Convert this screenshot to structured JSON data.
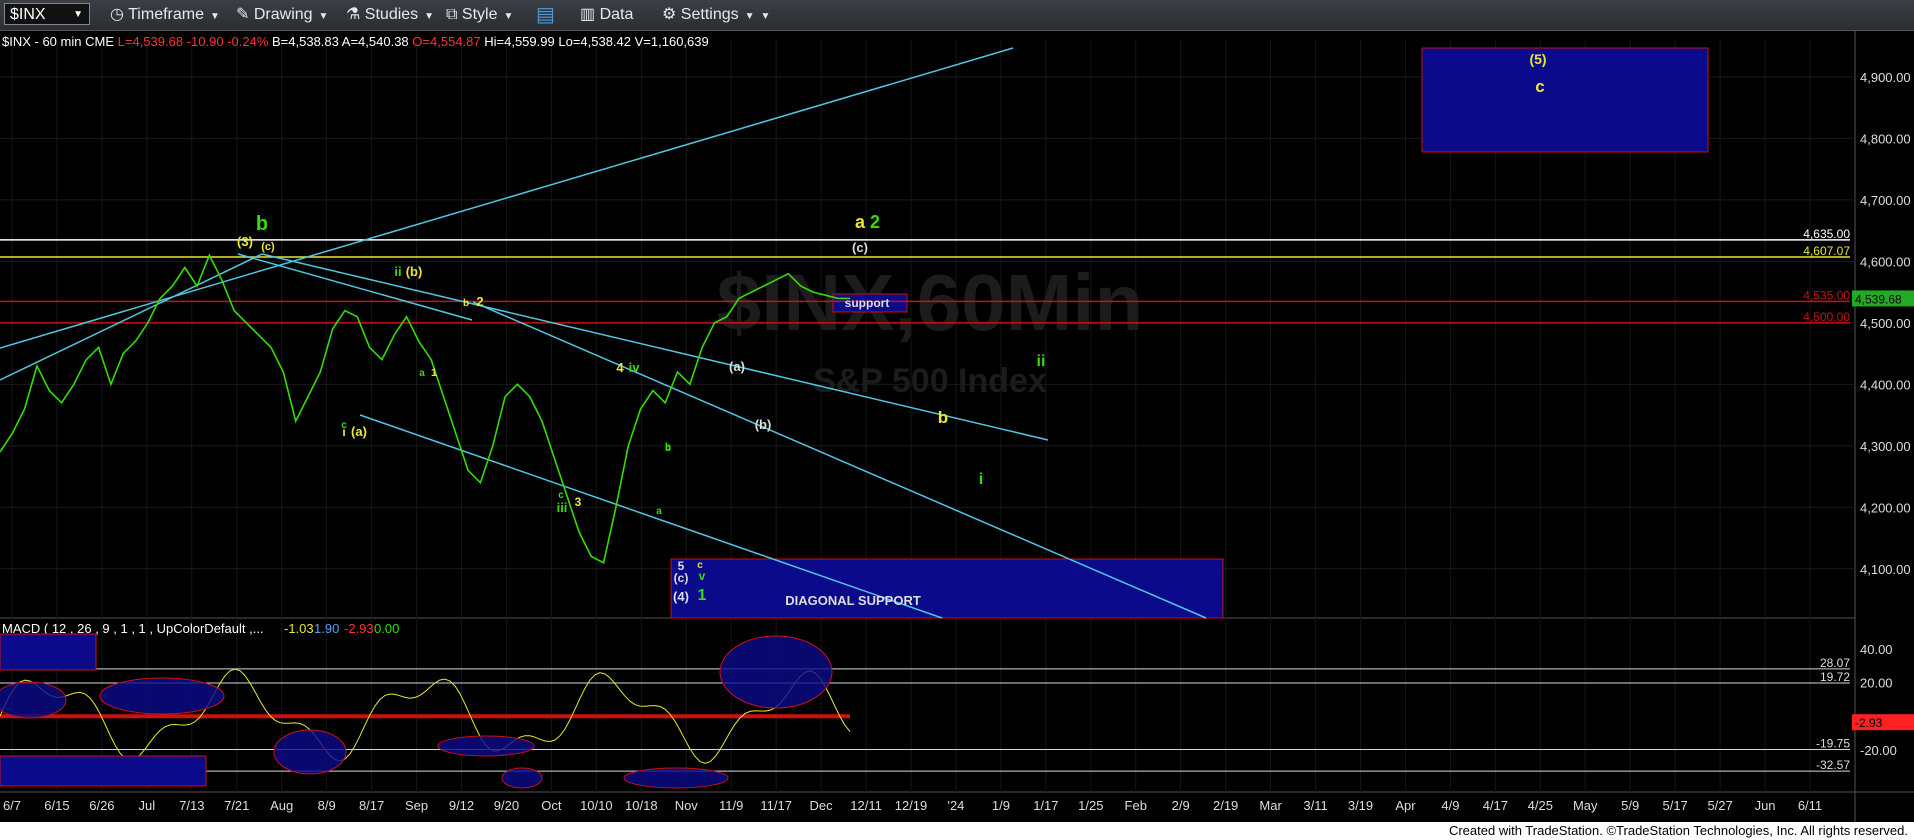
{
  "toolbar": {
    "symbol": "$INX",
    "items": [
      {
        "label": "Timeframe",
        "icon": "clock-icon"
      },
      {
        "label": "Drawing",
        "icon": "pencil-icon"
      },
      {
        "label": "Studies",
        "icon": "flask-icon"
      },
      {
        "label": "Style",
        "icon": "style-icon"
      },
      {
        "label": "",
        "icon": "layout-icon"
      },
      {
        "label": "Data",
        "icon": "bar-chart-icon"
      },
      {
        "label": "Settings",
        "icon": "gear-icon"
      }
    ]
  },
  "symbol_line": {
    "name": "$INX - 60 min",
    "exchange": "CME",
    "last": "L=4,539.68",
    "change": "-10.90",
    "pct": "-0.24%",
    "bid": "B=4,538.83",
    "ask": "A=4,540.38",
    "open": "O=4,554.87",
    "high": "Hi=4,559.99",
    "low": "Lo=4,538.42",
    "volume": "V=1,160,639"
  },
  "watermark": {
    "title": "$INX,60Min",
    "subtitle": "S&P 500 Index"
  },
  "colors": {
    "wave_green": "#33dd00",
    "label_yellow": "#e8e830",
    "trendline": "#4fc8e0",
    "target_box": "#0a0a8a",
    "red_line": "#cc1111",
    "white_line": "#ffffff"
  },
  "footer": "Created with TradeStation. ©TradeStation Technologies, Inc. All rights reserved.",
  "chart_data": [
    {
      "type": "line",
      "title": "$INX - 60 min",
      "x_ticks": [
        "6/7",
        "6/15",
        "6/26",
        "Jul",
        "7/13",
        "7/21",
        "Aug",
        "8/9",
        "8/17",
        "Sep",
        "9/12",
        "9/20",
        "Oct",
        "10/10",
        "10/18",
        "Nov",
        "11/9",
        "11/17",
        "Dec",
        "12/11",
        "12/19",
        "'24",
        "1/9",
        "1/17",
        "1/25",
        "Feb",
        "2/9",
        "2/19",
        "Mar",
        "3/11",
        "3/19",
        "Apr",
        "4/9",
        "4/17",
        "4/25",
        "May",
        "5/9",
        "5/17",
        "5/27",
        "Jun",
        "6/11"
      ],
      "y_ticks": [
        "4,900.00",
        "4,800.00",
        "4,700.00",
        "4,600.00",
        "4,500.00",
        "4,400.00",
        "4,300.00",
        "4,200.00",
        "4,100.00"
      ],
      "ylim": [
        4020,
        4960
      ],
      "series": [
        {
          "x": [
            0,
            2,
            4,
            6,
            8,
            10,
            12,
            14,
            16,
            18,
            20,
            22,
            24,
            26,
            28,
            30,
            32,
            34,
            36,
            38,
            40,
            42,
            44,
            46,
            48,
            50,
            52,
            54,
            56,
            58,
            60,
            62,
            64,
            66,
            68,
            70,
            72,
            74,
            76,
            78,
            80,
            82,
            84,
            86,
            88,
            90,
            92,
            94,
            96,
            98,
            100,
            102,
            104,
            106,
            108,
            110,
            112,
            114,
            116,
            118,
            120,
            122,
            124,
            126,
            128,
            130,
            132,
            134,
            136,
            138
          ],
          "values": [
            4290,
            4320,
            4360,
            4430,
            4390,
            4370,
            4400,
            4440,
            4460,
            4400,
            4450,
            4470,
            4500,
            4540,
            4560,
            4590,
            4560,
            4610,
            4570,
            4520,
            4500,
            4480,
            4460,
            4420,
            4340,
            4380,
            4420,
            4490,
            4520,
            4510,
            4460,
            4440,
            4480,
            4510,
            4470,
            4440,
            4380,
            4320,
            4260,
            4240,
            4300,
            4380,
            4400,
            4380,
            4340,
            4280,
            4220,
            4160,
            4120,
            4110,
            4200,
            4300,
            4360,
            4390,
            4370,
            4420,
            4400,
            4460,
            4500,
            4510,
            4540,
            4550,
            4560,
            4570,
            4580,
            4560,
            4550,
            4545,
            4540,
            4539.68
          ]
        }
      ],
      "horizontal_levels": [
        {
          "value": 4635.0,
          "label": "4,635.00",
          "color": "#ffffff"
        },
        {
          "value": 4607.07,
          "label": "4,607.07",
          "color": "#e8e830"
        },
        {
          "value": 4535.0,
          "label": "4,535.00",
          "color": "#cc1111"
        },
        {
          "value": 4500.0,
          "label": "4,500.00",
          "color": "#cc1111"
        }
      ],
      "last_price_tag": "4,539.68",
      "annotations": [
        "b",
        "(3)",
        "(c)",
        "ii",
        "(b)",
        "b",
        "2",
        "a",
        "1",
        "i",
        "c",
        "(a)",
        "4",
        "iv",
        "b",
        "c",
        "iii",
        "3",
        "a",
        "b",
        "5",
        "c",
        "v",
        "(c)",
        "(4)",
        "1",
        "(a)",
        "(b)",
        "a",
        "2",
        "(c)",
        "support",
        "ii",
        "b",
        "i",
        "(5)",
        "c",
        "DIAGONAL SUPPORT"
      ]
    },
    {
      "type": "line",
      "title": "MACD ( 12 , 26 , 9 , 1 , 1 , UpColorDefault ,...",
      "header_values": [
        "-1.03",
        "1.90",
        "-2.93",
        "0.00"
      ],
      "header_colors": [
        "#e8e830",
        "#4fa0ff",
        "#ff3030",
        "#33dd00"
      ],
      "y_ticks": [
        "40.00",
        "20.00",
        "-20.00"
      ],
      "ylim": [
        -45,
        50
      ],
      "levels": [
        {
          "value": 28.07,
          "label": "28.07"
        },
        {
          "value": 19.72,
          "label": "19.72"
        },
        {
          "value": -19.75,
          "label": "-19.75"
        },
        {
          "value": -32.57,
          "label": "-32.57"
        }
      ],
      "current_tag": "-2.93",
      "zero_tag": "0.00"
    }
  ]
}
